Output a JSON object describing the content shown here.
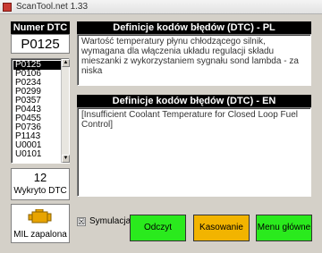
{
  "window": {
    "title": "ScanTool.net 1.33"
  },
  "left": {
    "header": "Numer DTC",
    "current_code": "P0125",
    "codes": [
      "P0125",
      "P0106",
      "P0234",
      "P0299",
      "P0357",
      "P0443",
      "P0455",
      "P0736",
      "P1143",
      "U0001",
      "U0101"
    ],
    "selected_code": "P0125",
    "count": "12",
    "count_label": "Wykryto DTC",
    "mil_label": "MIL zapalona"
  },
  "pl_panel": {
    "title": "Definicje kodów błędów (DTC) - PL",
    "text": "Wartość temperatury płynu chłodzącego silnik, wymagana dla włączenia układu regulacji składu mieszanki z wykorzystaniem sygnału sond lambda - za niska"
  },
  "en_panel": {
    "title": "Definicje kodów błędów (DTC) - EN",
    "text": "[Insufficient Coolant Temperature for Closed Loop Fuel Control]"
  },
  "simulation": {
    "label": "Symulacja",
    "checked": true,
    "mark": "☒"
  },
  "buttons": {
    "read": "Odczyt",
    "clear": "Kasowanie",
    "main_menu": "Menu główne"
  },
  "colors": {
    "title_bg": "#000000",
    "button_green": "#2aea1d",
    "button_orange": "#f2b400",
    "mil_amber": "#e8a400"
  },
  "icons": {
    "app": "scantool-app-icon",
    "mil": "check-engine-icon"
  }
}
